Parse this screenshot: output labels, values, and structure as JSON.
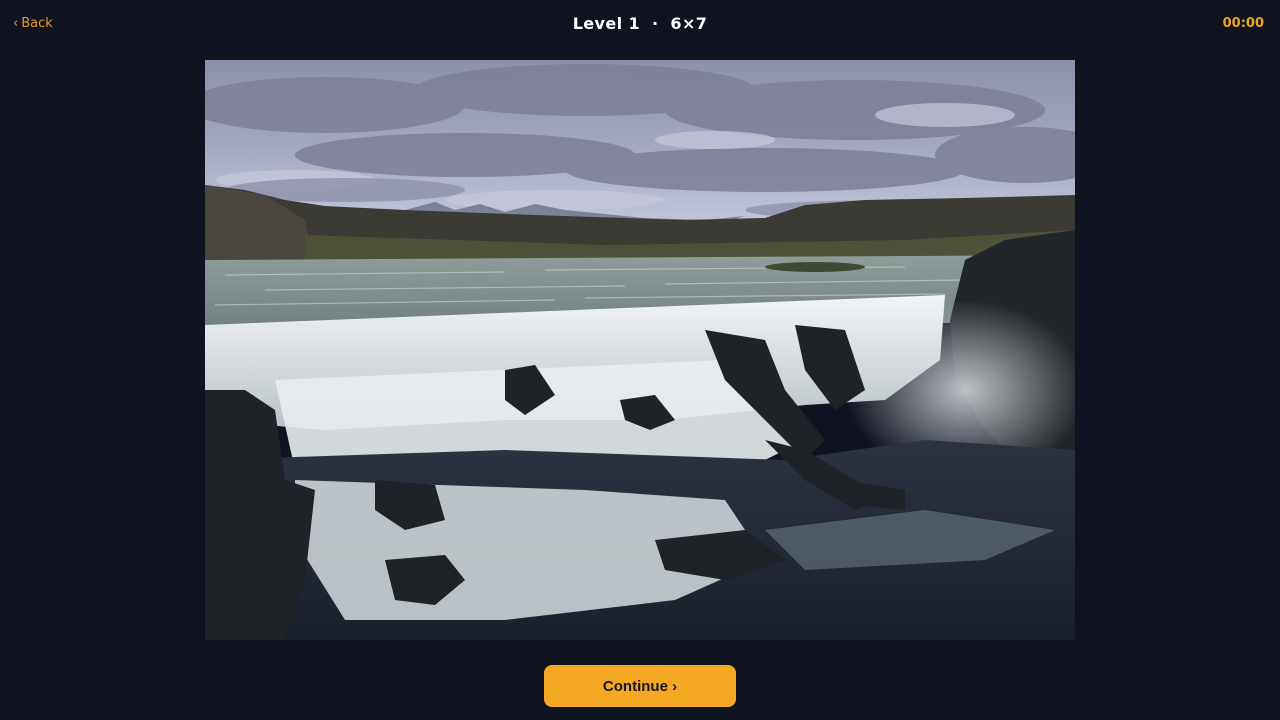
{
  "header": {
    "back_label": "Back",
    "back_icon": "chevron-left-icon",
    "level_label": "Level 1",
    "separator": "·",
    "grid_size": "6×7",
    "timer": "00:00"
  },
  "puzzle": {
    "image_subject": "waterfall landscape",
    "completed": true
  },
  "actions": {
    "continue_label": "Continue ›"
  },
  "colors": {
    "background": "#0f1420",
    "accent": "#f4a823",
    "timer": "#f0a526",
    "back_link": "#e59a22"
  }
}
